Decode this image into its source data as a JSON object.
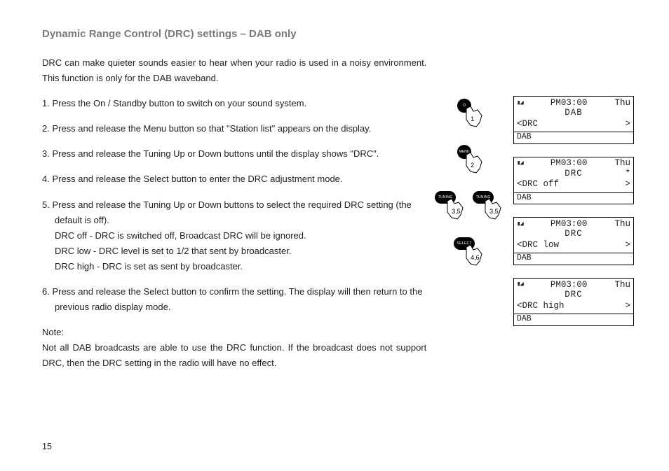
{
  "title": "Dynamic Range Control (DRC) settings – DAB only",
  "intro": "DRC can make quieter sounds easier to hear when your radio is used in a noisy environment. This function is only for the DAB waveband.",
  "steps": {
    "s1": "1. Press the On / Standby button to switch on your sound system.",
    "s2": "2. Press and release the Menu button so that \"Station list\" appears on the display.",
    "s3": "3. Press and release the Tuning Up or Down buttons until the display shows \"DRC\".",
    "s4": "4. Press and release the Select button to enter the DRC adjustment mode.",
    "s5a": "5. Press and release the Tuning Up or Down buttons to select the required DRC setting (the",
    "s5b": "default is off).",
    "s5c": "DRC off - DRC is switched off, Broadcast DRC will be ignored.",
    "s5d": "DRC low - DRC level is set to 1/2 that sent by broadcaster.",
    "s5e": "DRC high - DRC is set as sent by broadcaster.",
    "s6a": "6. Press and release the Select button to confirm the setting. The display will then return to the",
    "s6b": "previous radio display mode."
  },
  "note_label": "Note:",
  "note_body": "Not all DAB broadcasts are able to use the DRC function. If the broadcast does not support DRC, then the DRC setting in the radio will have no effect.",
  "icons": {
    "power_glyph": "⏻",
    "menu_glyph": "MENU",
    "tuning_down_glyph": "TUNING",
    "tuning_up_glyph": "TUNING",
    "select_glyph": "SELECT",
    "n1": "1",
    "n2": "2",
    "n35a": "3,5",
    "n35b": "3,5",
    "n46": "4,6"
  },
  "lcd_common": {
    "time": "PM03:00",
    "day": "Thu",
    "footer": "DAB",
    "arrow_l": "<",
    "arrow_r": ">",
    "star": "*"
  },
  "screens": [
    {
      "title": "DAB",
      "line": "DRC",
      "right": ">"
    },
    {
      "title": "DRC",
      "line": "DRC off",
      "right": ">",
      "star": true
    },
    {
      "title": "DRC",
      "line": "DRC low",
      "right": ">"
    },
    {
      "title": "DRC",
      "line": "DRC high",
      "right": ">"
    }
  ],
  "page_number": "15"
}
